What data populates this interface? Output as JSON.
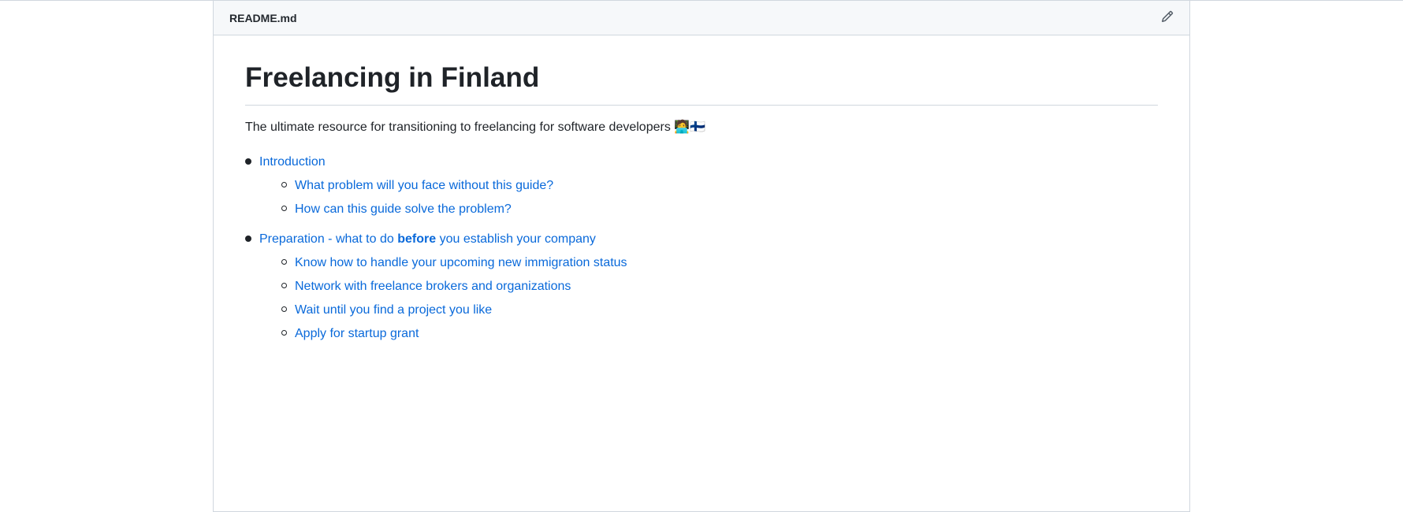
{
  "header": {
    "filename": "README.md",
    "edit_icon": "✏"
  },
  "readme": {
    "title": "Freelancing in Finland",
    "subtitle_text": "The ultimate resource for transitioning to freelancing for software developers",
    "subtitle_emojis": "🧑‍💻🇫🇮",
    "toc": [
      {
        "label": "Introduction",
        "children": [
          {
            "label": "What problem will you face without this guide?"
          },
          {
            "label": "How can this guide solve the problem?"
          }
        ]
      },
      {
        "label_prefix": "Preparation - what to do ",
        "label_bold": "before",
        "label_suffix": " you establish your company",
        "children": [
          {
            "label": "Know how to handle your upcoming new immigration status"
          },
          {
            "label": "Network with freelance brokers and organizations"
          },
          {
            "label": "Wait until you find a project you like"
          },
          {
            "label": "Apply for startup grant"
          }
        ]
      }
    ]
  },
  "colors": {
    "link": "#0969da",
    "text": "#1f2328",
    "border": "#d0d7de"
  }
}
